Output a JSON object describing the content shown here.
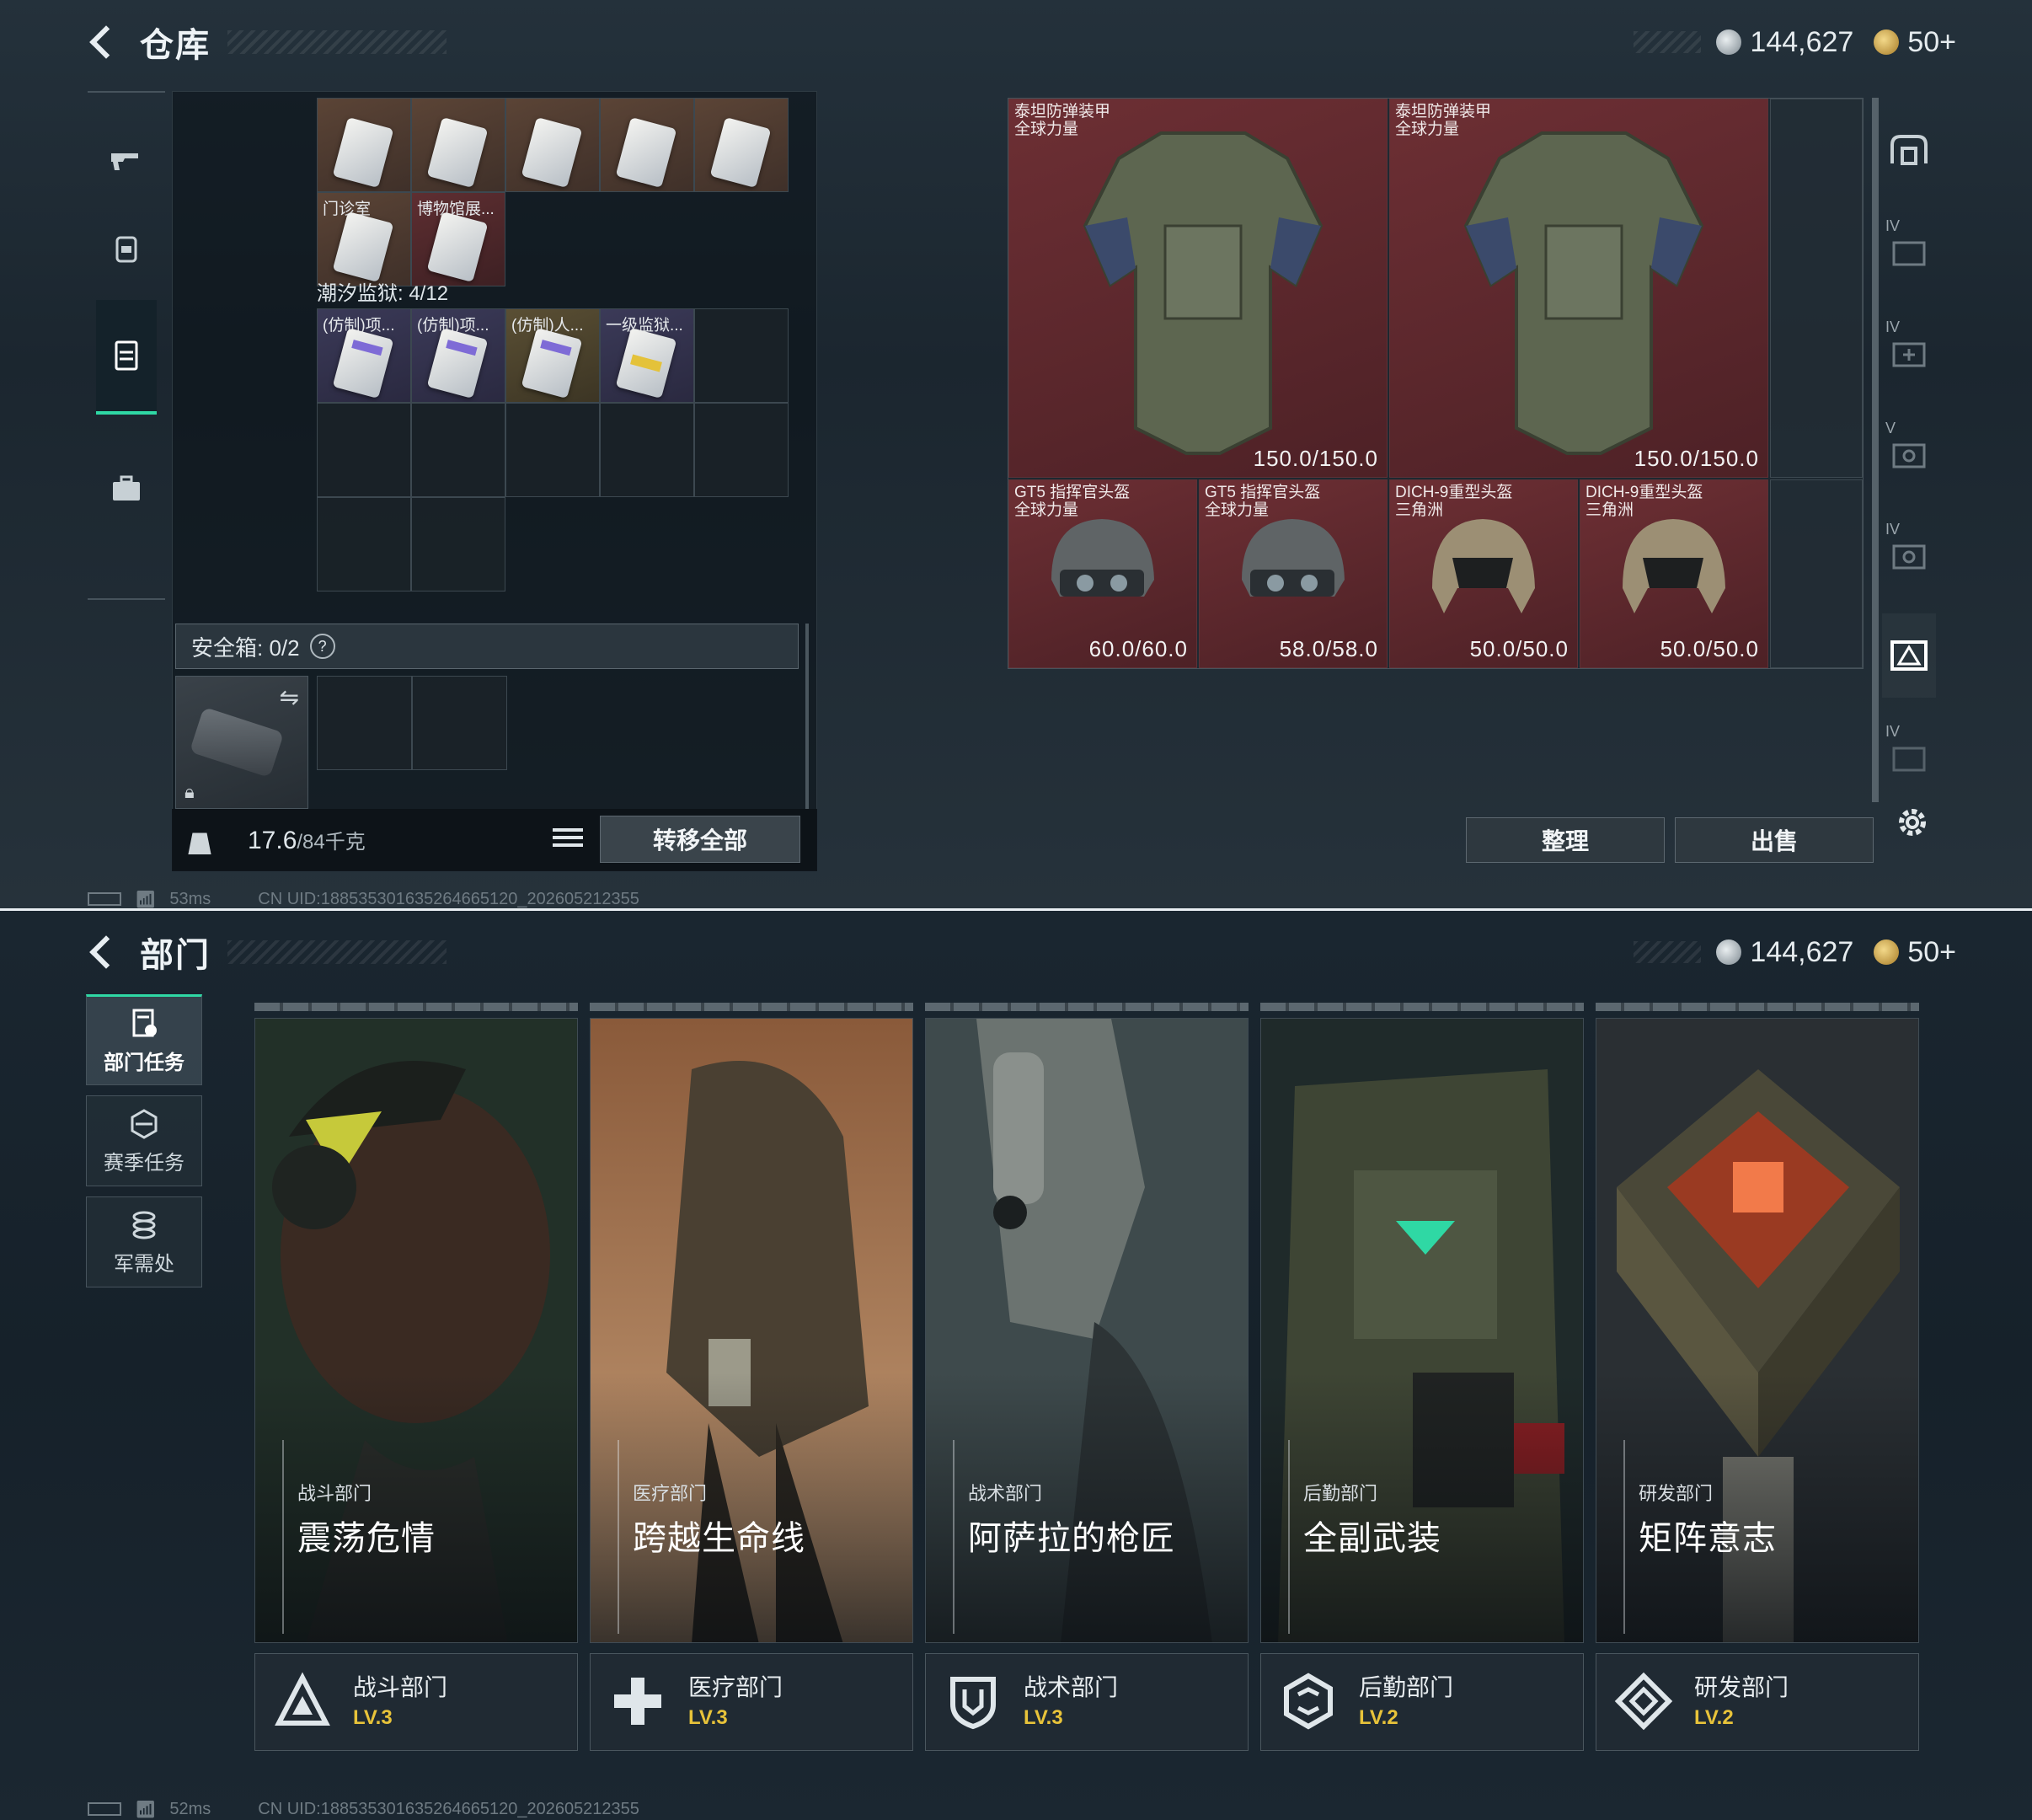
{
  "warehouse": {
    "title": "仓库",
    "currency": {
      "silver": "144,627",
      "gold": "50+"
    },
    "rail_icons": [
      "gun-icon",
      "backpack-icon",
      "locker-icon",
      "briefcase-icon"
    ],
    "backpack": {
      "top_row": [
        {
          "label": "",
          "color": "brown"
        },
        {
          "label": "",
          "color": "brown"
        },
        {
          "label": "",
          "color": "brown"
        },
        {
          "label": "",
          "color": "brown"
        },
        {
          "label": "",
          "color": "brown"
        }
      ],
      "second_row": [
        {
          "label": "门诊室",
          "color": "brown"
        },
        {
          "label": "博物馆展...",
          "color": "red"
        }
      ],
      "section_label": "潮汐监狱: 4/12",
      "section_items": [
        {
          "label": "(仿制)项...",
          "color": "purple"
        },
        {
          "label": "(仿制)项...",
          "color": "purple"
        },
        {
          "label": "(仿制)人...",
          "color": "brown"
        },
        {
          "label": "一级监狱...",
          "color": "purple"
        }
      ],
      "safe_label": "安全箱: 0/2",
      "help": "?",
      "weight_current": "17.6",
      "weight_max": "/84千克",
      "transfer_all": "转移全部"
    },
    "storage": {
      "vests": [
        {
          "name1": "泰坦防弹装甲",
          "name2": "全球力量",
          "durability": "150.0/150.0"
        },
        {
          "name1": "泰坦防弹装甲",
          "name2": "全球力量",
          "durability": "150.0/150.0"
        }
      ],
      "helmets": [
        {
          "name1": "GT5 指挥官头盔",
          "name2": "全球力量",
          "durability": "60.0/60.0"
        },
        {
          "name1": "GT5 指挥官头盔",
          "name2": "全球力量",
          "durability": "58.0/58.0"
        },
        {
          "name1": "DICH-9重型头盔",
          "name2": "三角洲",
          "durability": "50.0/50.0"
        },
        {
          "name1": "DICH-9重型头盔",
          "name2": "三角洲",
          "durability": "50.0/50.0"
        }
      ],
      "organize": "整理",
      "sell": "出售",
      "tab_numerals": [
        "",
        "IV",
        "IV",
        "V",
        "IV",
        "",
        "IV"
      ]
    },
    "status": {
      "ping": "53ms",
      "uid": "CN UID:1885353016352646651​20_202605212355"
    }
  },
  "department": {
    "title": "部门",
    "currency": {
      "silver": "144,627",
      "gold": "50+"
    },
    "tabs": [
      {
        "label": "部门任务",
        "active": true
      },
      {
        "label": "赛季任务",
        "active": false
      },
      {
        "label": "军需处",
        "active": false
      }
    ],
    "cards": [
      {
        "category": "战斗部门",
        "name": "震荡危情",
        "dept": "战斗部门",
        "level": "LV.3"
      },
      {
        "category": "医疗部门",
        "name": "跨越生命线",
        "dept": "医疗部门",
        "level": "LV.3"
      },
      {
        "category": "战术部门",
        "name": "阿萨拉的枪匠",
        "dept": "战术部门",
        "level": "LV.3"
      },
      {
        "category": "后勤部门",
        "name": "全副武装",
        "dept": "后勤部门",
        "level": "LV.2"
      },
      {
        "category": "研发部门",
        "name": "矩阵意志",
        "dept": "研发部门",
        "level": "LV.2"
      }
    ],
    "status": {
      "ping": "52ms",
      "uid": "CN UID:188535301635264665120_202605212355"
    }
  }
}
